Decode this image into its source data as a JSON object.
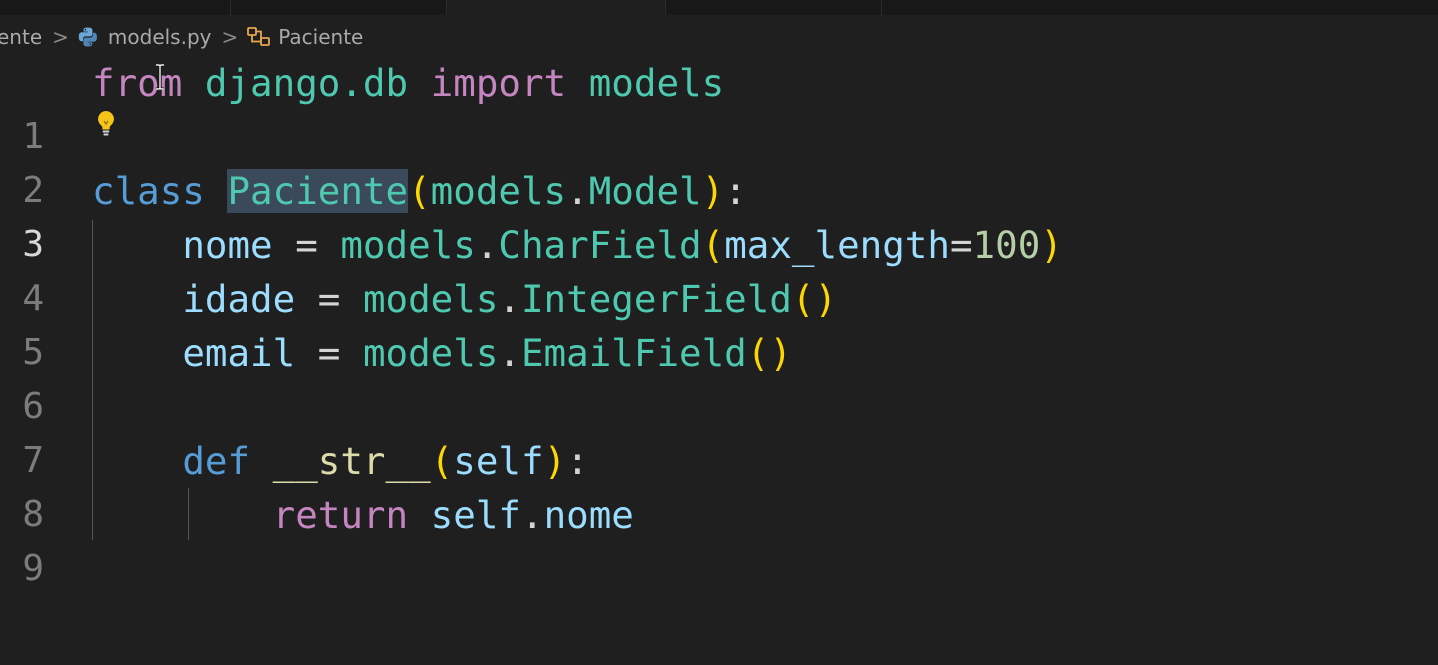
{
  "breadcrumb": {
    "folder": "ente",
    "file": "models.py",
    "symbol": "Paciente",
    "separator": ">"
  },
  "editor": {
    "current_line": 3,
    "lines": [
      {
        "number": "1",
        "text": "from django.db import models"
      },
      {
        "number": "2",
        "text": ""
      },
      {
        "number": "3",
        "text": "class Paciente(models.Model):"
      },
      {
        "number": "4",
        "text": "    nome = models.CharField(max_length=100)"
      },
      {
        "number": "5",
        "text": "    idade = models.IntegerField()"
      },
      {
        "number": "6",
        "text": "    email = models.EmailField()"
      },
      {
        "number": "7",
        "text": ""
      },
      {
        "number": "8",
        "text": "    def __str__(self):"
      },
      {
        "number": "9",
        "text": "        return self.nome"
      }
    ],
    "tokens": {
      "l1": {
        "from": "from",
        "mod": "django.db",
        "import": "import",
        "name": "models"
      },
      "l3": {
        "class": "class",
        "name": "Paciente",
        "open": "(",
        "base_mod": "models",
        "dot": ".",
        "base": "Model",
        "close": ")",
        "colon": ":"
      },
      "l4": {
        "var": "nome",
        "eq": "=",
        "mod": "models",
        "dot": ".",
        "cls": "CharField",
        "open": "(",
        "kw": "max_length",
        "eq2": "=",
        "num": "100",
        "close": ")"
      },
      "l5": {
        "var": "idade",
        "eq": "=",
        "mod": "models",
        "dot": ".",
        "cls": "IntegerField",
        "open": "(",
        "close": ")"
      },
      "l6": {
        "var": "email",
        "eq": "=",
        "mod": "models",
        "dot": ".",
        "cls": "EmailField",
        "open": "(",
        "close": ")"
      },
      "l8": {
        "def": "def",
        "fn": "__str__",
        "open": "(",
        "param": "self",
        "close": ")",
        "colon": ":"
      },
      "l9": {
        "ret": "return",
        "self": "self",
        "dot": ".",
        "attr": "nome"
      }
    }
  },
  "icons": {
    "file": "python-file-icon",
    "symbol": "class-symbol-icon",
    "code_action": "lightbulb-icon",
    "mouse": "text-cursor-icon"
  },
  "colors": {
    "background": "#1f1f1f",
    "keyword_control": "#c586c0",
    "keyword_storage": "#569cd6",
    "type": "#4ec9b0",
    "variable": "#9cdcfe",
    "function": "#dcdcaa",
    "number": "#b5cea8",
    "bracket": "#ffd700",
    "selection": "#3b4a5a"
  }
}
